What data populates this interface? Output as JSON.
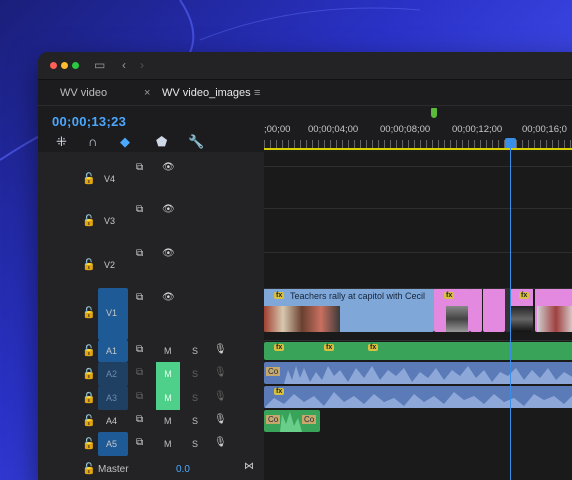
{
  "window": {
    "tabs": [
      {
        "label": "WV video"
      },
      {
        "label": "WV video_images"
      }
    ],
    "tab_close": "×",
    "tab_menu": "≡"
  },
  "timeline": {
    "timecode": "00;00;13;23",
    "ruler_labels": [
      ";00;00",
      "00;00;04;00",
      "00;00;08;00",
      "00;00;12;00",
      "00;00;16;0"
    ]
  },
  "tracks": {
    "video": [
      {
        "name": "V4",
        "eye": true
      },
      {
        "name": "V3",
        "eye": true
      },
      {
        "name": "V2",
        "eye": true
      },
      {
        "name": "V1",
        "eye": true
      }
    ],
    "audio": [
      {
        "name": "A1",
        "m": "M",
        "s": "S"
      },
      {
        "name": "A2",
        "m": "M",
        "s": "S"
      },
      {
        "name": "A3",
        "m": "M",
        "s": "S"
      },
      {
        "name": "A4",
        "m": "M",
        "s": "S"
      },
      {
        "name": "A5",
        "m": "M",
        "s": "S"
      }
    ],
    "master": {
      "label": "Master",
      "value": "0.0"
    }
  },
  "clips": {
    "v1_main_title": "Teachers rally at capitol with Cecil",
    "fx_label": "fx",
    "a_clip_label_1": "Co",
    "a_clip_label_2": "Co",
    "a_clip_label_3": "Co",
    "a_clip_label_4": "Co"
  },
  "colors": {
    "accent": "#4aa8ff",
    "video_clip": "#7fa8d8",
    "pink_clip": "#e38ae0",
    "audio_green": "#3aa35a",
    "audio_blue": "#5a7ab8",
    "playhead": "#3a8ee8"
  }
}
